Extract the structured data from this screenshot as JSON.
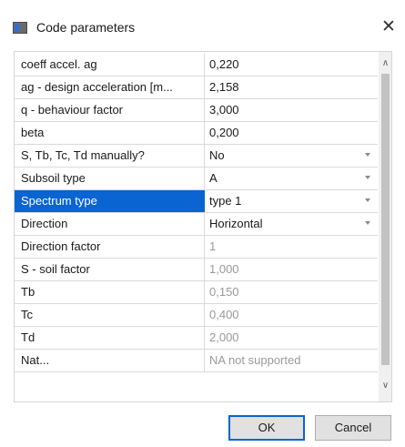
{
  "window": {
    "title": "Code parameters",
    "close_glyph": "✕"
  },
  "grid": {
    "rows": [
      {
        "name": "coeff accel. ag",
        "value": "0,220",
        "dropdown": false,
        "readonly": false,
        "selected": false
      },
      {
        "name": "ag - design acceleration [m...",
        "value": "2,158",
        "dropdown": false,
        "readonly": false,
        "selected": false
      },
      {
        "name": "q - behaviour factor",
        "value": "3,000",
        "dropdown": false,
        "readonly": false,
        "selected": false
      },
      {
        "name": "beta",
        "value": "0,200",
        "dropdown": false,
        "readonly": false,
        "selected": false
      },
      {
        "name": "S, Tb, Tc, Td manually?",
        "value": "No",
        "dropdown": true,
        "readonly": false,
        "selected": false
      },
      {
        "name": "Subsoil type",
        "value": "A",
        "dropdown": true,
        "readonly": false,
        "selected": false
      },
      {
        "name": "Spectrum type",
        "value": "type 1",
        "dropdown": true,
        "readonly": false,
        "selected": true
      },
      {
        "name": "Direction",
        "value": "Horizontal",
        "dropdown": true,
        "readonly": false,
        "selected": false
      },
      {
        "name": "Direction factor",
        "value": "1",
        "dropdown": false,
        "readonly": true,
        "selected": false
      },
      {
        "name": "S - soil factor",
        "value": "1,000",
        "dropdown": false,
        "readonly": true,
        "selected": false
      },
      {
        "name": "Tb",
        "value": "0,150",
        "dropdown": false,
        "readonly": true,
        "selected": false
      },
      {
        "name": "Tc",
        "value": "0,400",
        "dropdown": false,
        "readonly": true,
        "selected": false
      },
      {
        "name": "Td",
        "value": "2,000",
        "dropdown": false,
        "readonly": true,
        "selected": false
      },
      {
        "name": "Nat...",
        "value": "NA not supported",
        "dropdown": false,
        "readonly": true,
        "selected": false
      }
    ]
  },
  "scrollbar": {
    "up_glyph": "∧",
    "down_glyph": "∨"
  },
  "buttons": {
    "ok_label": "OK",
    "cancel_label": "Cancel"
  },
  "colors": {
    "selection": "#0a64d2",
    "readonly_text": "#9a9a9a",
    "grid_line": "#dadada"
  }
}
